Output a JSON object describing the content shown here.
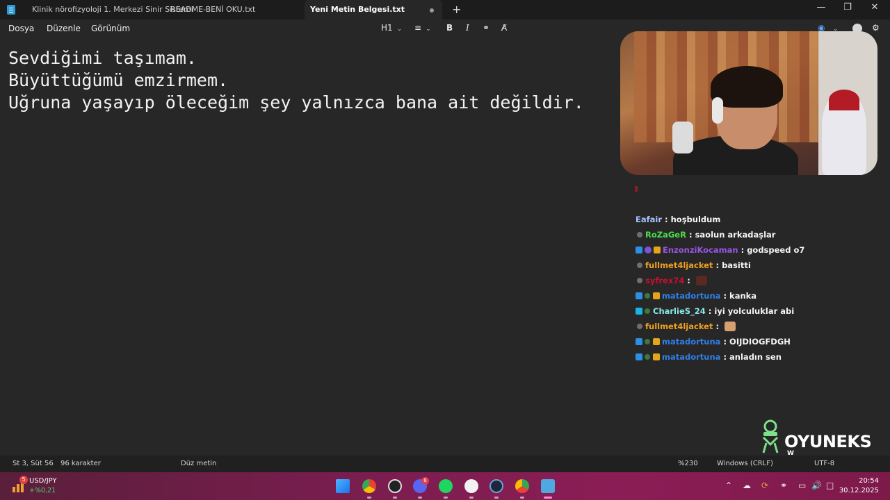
{
  "titlebar": {
    "tabs": [
      {
        "label": "Klinik nörofizyoloji 1. Merkezi Sinir Sistemi",
        "active": false
      },
      {
        "label": "README-BENİ OKU.txt",
        "active": false
      },
      {
        "label": "Yeni Metin Belgesi.txt",
        "active": true
      }
    ],
    "new_tab": "+",
    "minimize": "—",
    "maximize": "❐",
    "close": "✕"
  },
  "menubar": {
    "items": [
      "Dosya",
      "Düzenle",
      "Görünüm"
    ],
    "heading": "H1",
    "toolbar_icons": [
      "list-icon",
      "bold-icon",
      "italic-icon",
      "link-icon",
      "clear-format-icon"
    ],
    "bold": "B",
    "italic": "I"
  },
  "editor": {
    "lines": [
      "Sevdiğimi taşımam.",
      "Büyüttüğümü emzirmem.",
      "Uğruna yaşayıp öleceğim şey yalnızca bana ait değildir."
    ]
  },
  "chat": {
    "messages": [
      {
        "user": "Eafair",
        "color": "#a8c6ff",
        "text": "hoşbuldum",
        "badges": []
      },
      {
        "user": "RoZaGeR",
        "color": "#4ae04a",
        "text": "saolun arkadaşlar",
        "badges": [
          "grey"
        ]
      },
      {
        "user": "EnzonziKocaman",
        "color": "#9b55e8",
        "text": "godspeed o7",
        "badges": [
          "blue",
          "purple",
          "gold"
        ]
      },
      {
        "user": "fullmet4ljacket",
        "color": "#f0a020",
        "text": "basitti",
        "badges": [
          "grey"
        ]
      },
      {
        "user": "syfrex74",
        "color": "#c8102e",
        "text": "",
        "badges": [
          "grey"
        ],
        "emote": true
      },
      {
        "user": "matadortuna",
        "color": "#2f7fe8",
        "text": "kanka",
        "badges": [
          "blue",
          "green",
          "gold"
        ]
      },
      {
        "user": "CharlieS_24",
        "color": "#8ae8e8",
        "text": "iyi yolculuklar abi",
        "badges": [
          "cyan",
          "green"
        ]
      },
      {
        "user": "fullmet4ljacket",
        "color": "#f0a020",
        "text": "",
        "badges": [
          "grey"
        ],
        "emote": true
      },
      {
        "user": "matadortuna",
        "color": "#2f7fe8",
        "text": "OIJDIOGFDGH",
        "badges": [
          "blue",
          "green",
          "gold"
        ]
      },
      {
        "user": "matadortuna",
        "color": "#2f7fe8",
        "text": "anladın sen",
        "badges": [
          "blue",
          "green",
          "gold"
        ]
      }
    ]
  },
  "logo": {
    "text": "OYUNEKS",
    "sub": "W"
  },
  "statusbar": {
    "position": "St 3, Süt 56",
    "chars": "96 karakter",
    "format": "Düz metin",
    "zoom": "%230",
    "line_ending": "Windows (CRLF)",
    "encoding": "UTF-8"
  },
  "taskbar": {
    "weather_badge": "5",
    "ticker_name": "USD/JPY",
    "ticker_value": "+%0,21",
    "apps": [
      "windows-start-icon",
      "chrome-icon",
      "obs-icon",
      "discord-icon",
      "spotify-icon",
      "steelseries-icon",
      "steam-icon",
      "chrome-profile-icon",
      "notepad-icon"
    ],
    "discord_badge": "8",
    "time": "20:54",
    "date": "30.12.2025"
  }
}
